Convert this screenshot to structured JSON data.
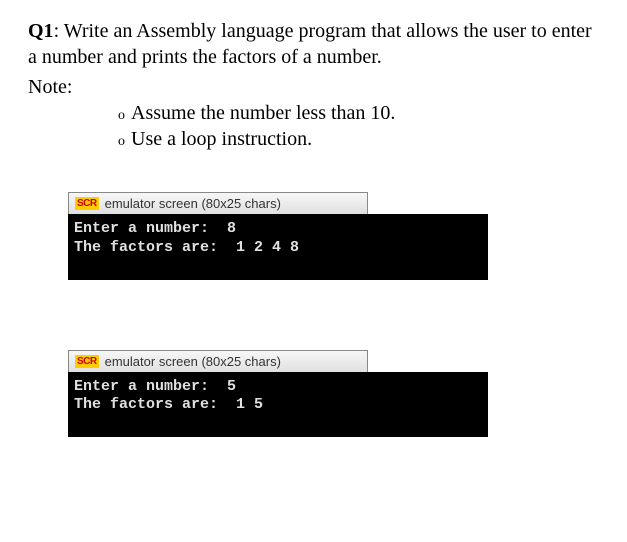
{
  "question": {
    "label": "Q1",
    "text": ": Write an Assembly language program that allows the user to enter a number and prints the factors of a number."
  },
  "note": {
    "label": "Note:",
    "items": [
      "Assume the number less than 10.",
      "Use a loop instruction."
    ]
  },
  "bullet_marker": "o",
  "emulators": [
    {
      "icon_text": "SCR",
      "title": "emulator screen (80x25 chars)",
      "console_lines": [
        "Enter a number:  8",
        "The factors are:  1 2 4 8"
      ]
    },
    {
      "icon_text": "SCR",
      "title": "emulator screen (80x25 chars)",
      "console_lines": [
        "Enter a number:  5",
        "The factors are:  1 5"
      ]
    }
  ]
}
